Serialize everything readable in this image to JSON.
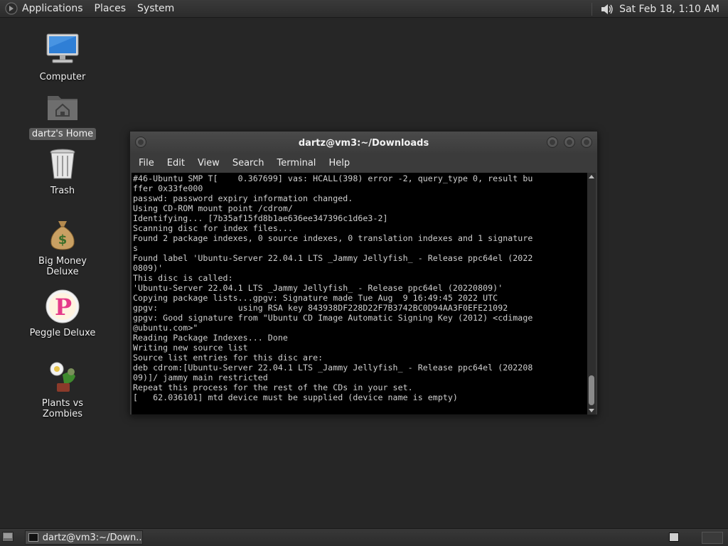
{
  "top_panel": {
    "menus": [
      "Applications",
      "Places",
      "System"
    ],
    "clock": "Sat Feb 18,  1:10 AM",
    "icons": {
      "menu_logo": "gnome-foot-icon",
      "volume": "speaker-icon"
    }
  },
  "desktop": {
    "icons": [
      {
        "label": "Computer",
        "icon": "computer-icon"
      },
      {
        "label": "dartz's Home",
        "icon": "home-folder-icon",
        "selected": true
      },
      {
        "label": "Trash",
        "icon": "trash-icon"
      },
      {
        "label": "Big Money Deluxe",
        "icon": "money-bag-icon"
      },
      {
        "label": "Peggle Deluxe",
        "icon": "peggle-icon"
      },
      {
        "label": "Plants vs Zombies",
        "icon": "plants-vs-zombies-icon"
      }
    ]
  },
  "window": {
    "title": "dartz@vm3:~/Downloads",
    "menu": [
      "File",
      "Edit",
      "View",
      "Search",
      "Terminal",
      "Help"
    ],
    "terminal_lines": [
      "#46-Ubuntu SMP T[    0.367699] vas: HCALL(398) error -2, query_type 0, result bu",
      "ffer 0x33fe000",
      "passwd: password expiry information changed.",
      "Using CD-ROM mount point /cdrom/",
      "Identifying... [7b35af15fd8b1ae636ee347396c1d6e3-2]",
      "Scanning disc for index files...",
      "Found 2 package indexes, 0 source indexes, 0 translation indexes and 1 signature",
      "s",
      "Found label 'Ubuntu-Server 22.04.1 LTS _Jammy Jellyfish_ - Release ppc64el (2022",
      "0809)'",
      "This disc is called:",
      "'Ubuntu-Server 22.04.1 LTS _Jammy Jellyfish_ - Release ppc64el (20220809)'",
      "Copying package lists...gpgv: Signature made Tue Aug  9 16:49:45 2022 UTC",
      "gpgv:                using RSA key 843938DF228D22F7B3742BC0D94AA3F0EFE21092",
      "gpgv: Good signature from \"Ubuntu CD Image Automatic Signing Key (2012) <cdimage",
      "@ubuntu.com>\"",
      "Reading Package Indexes... Done",
      "Writing new source list",
      "Source list entries for this disc are:",
      "deb cdrom:[Ubuntu-Server 22.04.1 LTS _Jammy Jellyfish_ - Release ppc64el (202208",
      "09)]/ jammy main restricted",
      "Repeat this process for the rest of the CDs in your set.",
      "[   62.036101] mtd device must be supplied (device name is empty)"
    ]
  },
  "bottom_panel": {
    "task_label": "dartz@vm3:~/Down..."
  }
}
